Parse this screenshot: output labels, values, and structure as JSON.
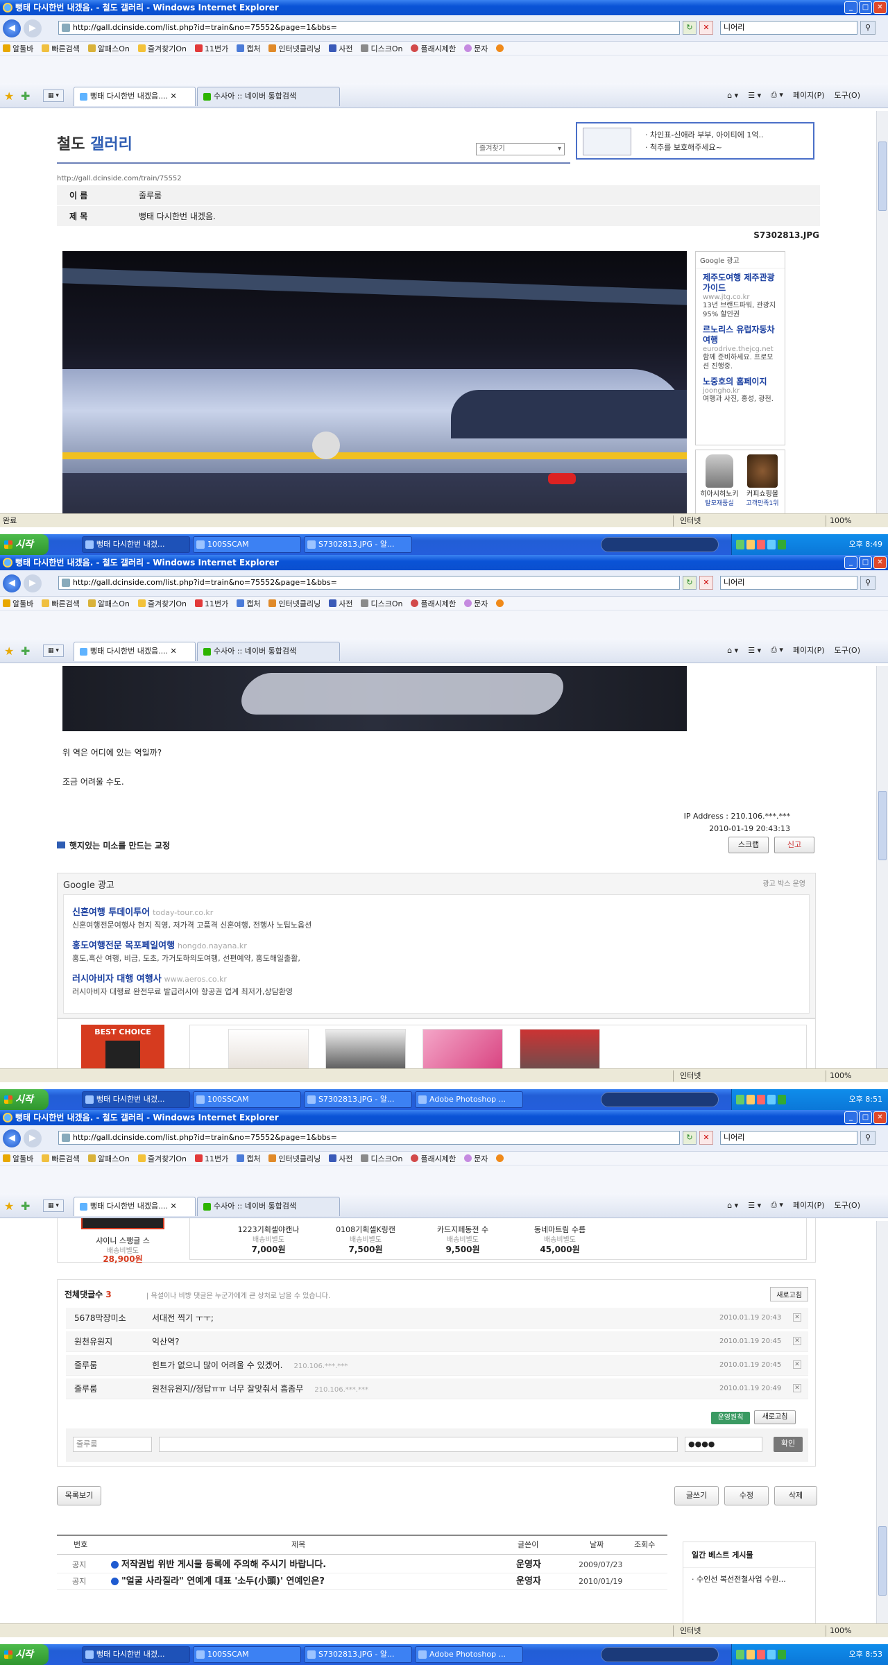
{
  "window": {
    "title": "뻥태 다시한번 내겠음. - 철도 갤러리 - Windows Internet Explorer",
    "url": "http://gall.dcinside.com/list.php?id=train&no=75552&page=1&bbs=",
    "search_value": "니어리"
  },
  "toolbar": {
    "items": [
      "알툴바",
      "빠른검색",
      "알패스On",
      "즐겨찾기On",
      "11번가",
      "캡처",
      "인터넷클리닝",
      "사전",
      "디스크On",
      "플래시제한",
      "문자"
    ]
  },
  "tabs": [
    {
      "label": "뻥태 다시한번 내겠음...."
    },
    {
      "label": "수사아 :: 네이버 통합검색"
    }
  ],
  "commandbar": {
    "page": "페이지(P)",
    "tools": "도구(O)"
  },
  "status": {
    "done": "완료",
    "zone": "인터넷",
    "zoom": "100%"
  },
  "taskbar": {
    "start": "시작",
    "buttons": [
      "뻥태 다시한번 내겠...",
      "100SSCAM",
      "S7302813.JPG - 알...",
      "Adobe Photoshop ..."
    ],
    "times": [
      "오후 8:49",
      "오후 8:51",
      "오후 8:53"
    ]
  },
  "gallery": {
    "title_a": "철도",
    "title_b": "갤러리",
    "select_label": "즐겨찾기",
    "ad_line1": "· 차인표-신애라 부부, 아이티에 1억..",
    "ad_line2": "· 척추를 보호해주세요~",
    "post_url": "http://gall.dcinside.com/train/75552"
  },
  "post": {
    "name_key": "이  름",
    "name_val": "줄루룸",
    "subject_key": "제  목",
    "subject_val": "뻥태 다시한번 내겠음.",
    "filename": "S7302813.JPG",
    "body_line1": "위 역은 어디에 있는 역일까?",
    "body_line2": "조금 어려울 수도.",
    "ip": "IP Address : 210.106.***.***",
    "datetime": "2010-01-19 20:43:13",
    "link_text": "햇지있는 미소를 만드는 교정",
    "scrap": "스크랩",
    "report": "신고"
  },
  "side_ads": {
    "header": "Google 광고",
    "items": [
      {
        "title": "제주도여행 제주관광가이드",
        "url": "www.jtg.co.kr",
        "desc": "13년 브랜드파워, 관광지 95% 할인권"
      },
      {
        "title": "르노리스 유럽자동차여행",
        "url": "eurodrive.thejcg.net",
        "desc": "함께 준비하세요. 프로모션 진행중."
      },
      {
        "title": "노중호의 홈페이지",
        "url": "joongho.kr",
        "desc": "여행과 사진, 홍성, 광천."
      }
    ],
    "products": [
      {
        "name": "히아시히노키",
        "sub": "탈모재품실"
      },
      {
        "name": "커피쇼핑몰",
        "sub": "고객만족1위"
      }
    ]
  },
  "google_box": {
    "header": "Google 광고",
    "right": "광고 박스 운영",
    "items": [
      {
        "title": "신혼여행 투데이투어",
        "url": "today-tour.co.kr",
        "desc": "신혼여행전문여행사 현지 직영, 저가격 고품격 신혼여행, 전행사 노팁노옵션"
      },
      {
        "title": "홍도여행전문 목포페일여행",
        "url": "hongdo.nayana.kr",
        "desc": "홍도,흑산 여행, 비금, 도초, 가거도하의도여행, 선편예약, 홍도해일출활,"
      },
      {
        "title": "러시아비자 대행 여행사",
        "url": "www.aeros.co.kr",
        "desc": "러시아비자 대행료 완전무료 발급러시아 항공권 업계 최저가,상담환영"
      }
    ]
  },
  "shop": {
    "best_choice": "BEST CHOICE",
    "main_name": "샤이니 스팽글 스",
    "main_ship": "배송비별도",
    "main_price": "28,900원",
    "products": [
      {
        "name": "1223기획셀야캔나",
        "ship": "배송비별도",
        "price": "7,000원"
      },
      {
        "name": "0108기획셀K링캔",
        "ship": "배송비별도",
        "price": "7,500원"
      },
      {
        "name": "카드지페동전 수",
        "ship": "배송비별도",
        "price": "9,500원"
      },
      {
        "name": "동네마트림 수름",
        "ship": "배송비별도",
        "price": "45,000원"
      }
    ]
  },
  "comments": {
    "label": "전체댓글수",
    "count": "3",
    "notice": "| 욕설이나 비방 댓글은 누군가에게 큰 상처로 남을 수 있습니다.",
    "reload": "새로고침",
    "items": [
      {
        "name": "5678막장미소",
        "text": "서대전 찍기 ㅜㅜ;",
        "ip": "",
        "date": "2010.01.19 20:43"
      },
      {
        "name": "원천유원지",
        "text": "익산역?",
        "ip": "",
        "date": "2010.01.19 20:45"
      },
      {
        "name": "줄루룸",
        "text": "힌트가 없으니 많이 어려울 수 있겠어.",
        "ip": "210.106.***.***",
        "date": "2010.01.19 20:45"
      },
      {
        "name": "줄루룸",
        "text": "원천유원지//정답ㅠㅠ 너무 잘맞춰서 흠좀무",
        "ip": "210.106.***.***",
        "date": "2010.01.19 20:49"
      }
    ],
    "rules_btn": "운영원칙",
    "reload2": "새로고침",
    "name_field": "줄루룸",
    "pw_field": "●●●●",
    "submit": "확인"
  },
  "buttons": {
    "list": "목록보기",
    "write": "글쓰기",
    "edit": "수정",
    "delete": "삭제"
  },
  "list": {
    "headers": [
      "번호",
      "제목",
      "글쓴이",
      "날짜",
      "조회수"
    ],
    "rows": [
      {
        "no": "공지",
        "title": "저작권법 위반 게시물 등록에 주의해 주시기 바랍니다.",
        "writer": "운영자",
        "date": "2009/07/23"
      },
      {
        "no": "공지",
        "title": "\"얼굴 사라질라\" 연예계 대표 '소두(小頭)' 연예인은?",
        "writer": "운영자",
        "date": "2010/01/19"
      }
    ]
  },
  "best": {
    "title": "일간 베스트 게시물",
    "item": "· 수인선 복선전철사업 수원..."
  },
  "colors": {
    "accent": "#2e5db3",
    "xp_blue": "#0b4fcf",
    "start_green": "#2f962e"
  }
}
